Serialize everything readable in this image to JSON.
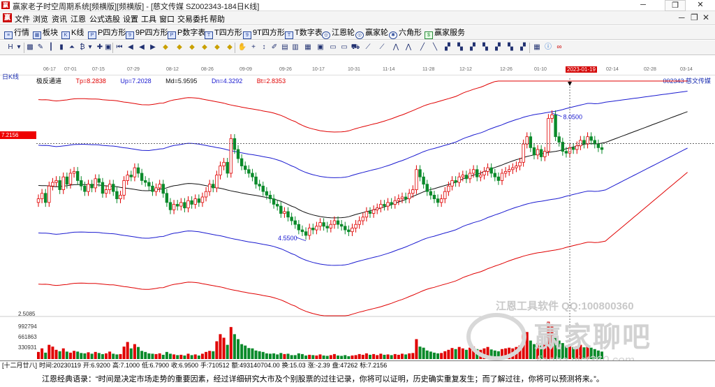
{
  "titlebar": {
    "text": "赢家老子时空周期系统[频横版][频横版] - [慈文传媒 SZ002343-184日K线]",
    "min": "─",
    "max": "❐",
    "close": "✕"
  },
  "menu": {
    "items": [
      "文件",
      "浏览",
      "资讯",
      "江恩",
      "公式选股",
      "设置",
      "工具",
      "窗口",
      "交易委托",
      "帮助"
    ],
    "right_min": "─",
    "right_restore": "❐",
    "right_close": "✕"
  },
  "nav": {
    "items": [
      "行情",
      "板块",
      "K线",
      "P四方形",
      "9P四方形",
      "P数字表",
      "T四方形",
      "9T四方形",
      "T数字表",
      "江恩轮",
      "赢家轮",
      "六角形",
      "赢家服务"
    ]
  },
  "toolbar": {
    "icons": [
      "H-icon",
      "dropdown-icon",
      "grid-icon",
      "pen-icon",
      "bars-icon",
      "candle-icon",
      "mountain-icon",
      "bars2-icon",
      "lines-icon",
      "dollar-icon",
      "dropdown2-icon",
      "cross-icon",
      "box-icon",
      "first-icon",
      "prev-icon",
      "play-left-icon",
      "play-right-icon",
      "diamond1-icon",
      "diamond2-icon",
      "diamond3-icon",
      "diamond4-icon",
      "diamond5-icon",
      "diamond6-icon",
      "diamond7-icon",
      "diamond8-icon",
      "diamond9-icon",
      "diamond10-icon",
      "hand-icon",
      "cross2-icon",
      "arrow-icon",
      "pencil-icon",
      "folder-icon",
      "save-icon",
      "print-icon",
      "screen-icon",
      "window-icon",
      "window2-icon",
      "car-icon",
      "ruler-icon",
      "fan-icon",
      "mountain2-icon",
      "mountain3-icon",
      "grid2-icon",
      "info-icon",
      "circle-icon",
      "infinity-icon"
    ]
  },
  "chart": {
    "period_label": "日K线",
    "indicator": "极反通道",
    "tp": "Tp=8.2838",
    "up": "Up=7.2028",
    "md": "Md=5.9595",
    "dn": "Dn=4.3292",
    "bt": "Bt=2.8353",
    "stock": "002343 慈文传媒",
    "dates": [
      "06-17",
      "07-01",
      "07-15",
      "07-29",
      "08-12",
      "08-26",
      "09-09",
      "09-26",
      "10-17",
      "10-31",
      "11-14",
      "11-28",
      "12-12",
      "12-26",
      "01-10",
      "2023-01-19",
      "02-14",
      "02-28",
      "03-14"
    ],
    "price_tag": "7.2156",
    "high_label": "8.0500",
    "low_label": "4.5500",
    "volume_labels": [
      "2.5085",
      "992794",
      "661863",
      "330931"
    ]
  },
  "chart_data": {
    "type": "candlestick",
    "title": "",
    "xlabel": "",
    "ylabel": "",
    "ylim": [
      2.5,
      9.0
    ],
    "high": 8.05,
    "low": 4.55,
    "current_price": 7.2156,
    "channel": {
      "Tp": 8.2838,
      "Up": 7.2028,
      "Md": 5.9595,
      "Dn": 4.3292,
      "Bt": 2.8353
    },
    "series": [
      {
        "name": "Tp",
        "color": "#e00000"
      },
      {
        "name": "Up",
        "color": "#1a1ad0"
      },
      {
        "name": "Md",
        "color": "#111111"
      },
      {
        "name": "Dn",
        "color": "#1a1ad0"
      },
      {
        "name": "Bt",
        "color": "#e00000"
      }
    ],
    "closes": [
      5.7,
      5.85,
      5.6,
      6.05,
      6.15,
      6.2,
      5.95,
      6.3,
      6.1,
      6.4,
      6.45,
      6.2,
      6.05,
      5.9,
      6.1,
      6.0,
      6.25,
      6.15,
      5.85,
      5.95,
      6.1,
      5.9,
      5.7,
      5.8,
      6.2,
      6.35,
      6.3,
      6.55,
      6.4,
      6.2,
      6.15,
      6.05,
      5.9,
      6.0,
      6.1,
      5.85,
      5.6,
      5.4,
      5.55,
      5.5,
      5.6,
      5.45,
      5.65,
      5.55,
      5.7,
      5.6,
      5.75,
      5.9,
      6.1,
      6.0,
      6.35,
      6.6,
      6.7,
      6.4,
      7.35,
      7.05,
      6.8,
      6.6,
      6.5,
      6.4,
      6.3,
      6.1,
      6.05,
      5.9,
      5.8,
      5.7,
      5.55,
      5.5,
      5.3,
      5.35,
      5.2,
      5.1,
      5.0,
      4.85,
      4.8,
      4.7,
      4.9,
      4.85,
      4.95,
      5.05,
      4.95,
      4.9,
      5.0,
      5.1,
      5.0,
      4.95,
      4.85,
      4.8,
      4.9,
      5.0,
      5.1,
      5.2,
      5.35,
      5.3,
      5.4,
      5.45,
      5.55,
      5.5,
      5.6,
      5.55,
      5.65,
      5.7,
      5.75,
      5.7,
      5.85,
      5.95,
      6.5,
      6.3,
      6.1,
      5.9,
      5.8,
      5.7,
      5.6,
      5.7,
      5.9,
      6.05,
      6.2,
      6.15,
      6.3,
      6.35,
      6.25,
      6.4,
      6.5,
      6.3,
      6.35,
      6.45,
      6.55,
      6.4,
      6.3,
      6.2,
      6.4,
      6.45,
      6.5,
      6.55,
      6.6,
      6.7,
      7.2,
      7.4,
      7.1,
      6.9,
      7.05,
      6.85,
      7.0,
      7.9,
      8.0,
      7.4,
      7.25,
      7.0,
      6.95,
      7.1,
      7.05,
      7.15,
      7.3,
      7.2,
      7.4,
      7.3,
      7.2,
      7.1,
      7.05
    ],
    "volume_ylim": [
      0,
      1100000
    ],
    "volumes": [
      200000,
      300000,
      180000,
      400000,
      350000,
      260000,
      220000,
      300000,
      210000,
      180000,
      230000,
      210000,
      170000,
      160000,
      190000,
      150000,
      200000,
      170000,
      140000,
      160000,
      210000,
      150000,
      130000,
      140000,
      350000,
      480000,
      300000,
      420000,
      340000,
      230000,
      200000,
      160000,
      150000,
      140000,
      160000,
      120000,
      200000,
      150000,
      130000,
      110000,
      120000,
      100000,
      150000,
      110000,
      130000,
      100000,
      150000,
      200000,
      230000,
      220000,
      500000,
      700000,
      600000,
      400000,
      900000,
      700000,
      560000,
      420000,
      380000,
      310000,
      300000,
      240000,
      220000,
      200000,
      160000,
      150000,
      160000,
      130000,
      170000,
      140000,
      150000,
      110000,
      110000,
      160000,
      140000,
      100000,
      120000,
      110000,
      100000,
      130000,
      100000,
      90000,
      110000,
      140000,
      100000,
      90000,
      110000,
      80000,
      100000,
      110000,
      140000,
      120000,
      160000,
      120000,
      140000,
      110000,
      150000,
      120000,
      130000,
      110000,
      140000,
      120000,
      150000,
      130000,
      160000,
      170000,
      560000,
      350000,
      320000,
      240000,
      210000,
      180000,
      160000,
      170000,
      220000,
      260000,
      310000,
      280000,
      340000,
      300000,
      260000,
      320000,
      350000,
      280000,
      260000,
      300000,
      340000,
      270000,
      240000,
      220000,
      280000,
      300000,
      320000,
      300000,
      340000,
      380000,
      700000,
      760000,
      520000,
      420000,
      450000,
      380000,
      420000,
      1050000,
      980000,
      600000,
      520000,
      450000,
      380000,
      420000,
      340000,
      360000,
      400000,
      330000,
      380000,
      320000,
      280000,
      240000,
      210000
    ]
  },
  "status": {
    "items": [
      "[十二月廿八]",
      "时间:20230119",
      "开:6.9200",
      "高:7.1000",
      "低:6.7900",
      "收:6.9500",
      "手:710512",
      "额:493140704.00",
      "换:15.03",
      "涨:-2.39",
      "盘:47262",
      "标:7.2156"
    ]
  },
  "quote": "江恩经典语录：“时间是决定市场走势的重要因素，经过详细研究大市及个别股票的过往记录，你将可以证明，历史确实重复发生；而了解过往，你将可以预测将来。”。",
  "watermark": {
    "line1": "江恩工具软件 QQ:100800360",
    "line2": "赢家聊吧",
    "line3": "liaoba.vict360.com"
  }
}
